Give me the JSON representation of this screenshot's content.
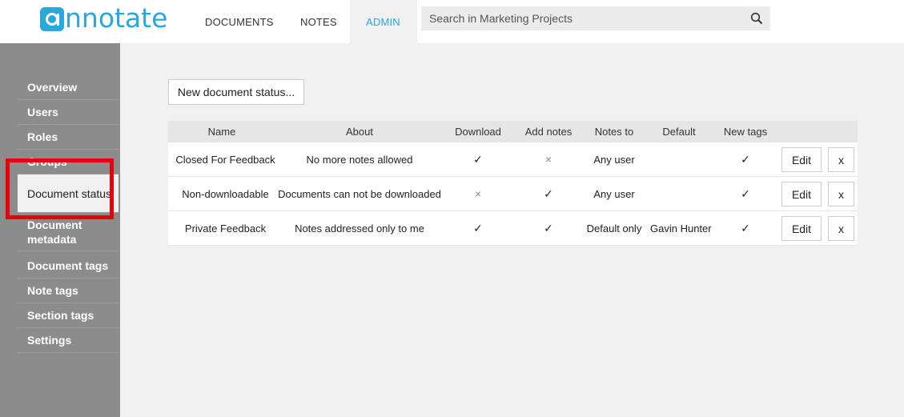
{
  "logo": {
    "text": "nnotate",
    "icon": "annotate-logo-a"
  },
  "nav": {
    "documents": "DOCUMENTS",
    "notes": "NOTES",
    "admin": "ADMIN"
  },
  "search": {
    "placeholder": "Search in Marketing Projects",
    "icon": "search-icon"
  },
  "sidebar": {
    "items": [
      {
        "label": "Overview"
      },
      {
        "label": "Users"
      },
      {
        "label": "Roles"
      },
      {
        "label": "Groups"
      },
      {
        "label": "Document status"
      },
      {
        "label": "Document metadata"
      },
      {
        "label": "Document tags"
      },
      {
        "label": "Note tags"
      },
      {
        "label": "Section tags"
      },
      {
        "label": "Settings"
      }
    ],
    "active": "Document status"
  },
  "main": {
    "new_button": "New document status...",
    "table": {
      "headers": [
        "Name",
        "About",
        "Download",
        "Add notes",
        "Notes to",
        "Default",
        "New tags"
      ],
      "rows": [
        {
          "name": "Closed For Feedback",
          "about": "No more notes allowed",
          "download": "✓",
          "add_notes": "×",
          "notes_to": "Any user",
          "default": "",
          "new_tags": "✓",
          "edit": "Edit",
          "delete": "x"
        },
        {
          "name": "Non-downloadable",
          "about": "Documents can not be downloaded",
          "download": "×",
          "add_notes": "✓",
          "notes_to": "Any user",
          "default": "",
          "new_tags": "✓",
          "edit": "Edit",
          "delete": "x"
        },
        {
          "name": "Private Feedback",
          "about": "Notes addressed only to me",
          "download": "✓",
          "add_notes": "✓",
          "notes_to": "Default only",
          "default": "Gavin Hunter",
          "new_tags": "✓",
          "edit": "Edit",
          "delete": "x"
        }
      ]
    }
  },
  "colors": {
    "accent": "#2aa7dc",
    "highlight": "#e8000b",
    "sidebar": "#8c8c8c"
  }
}
